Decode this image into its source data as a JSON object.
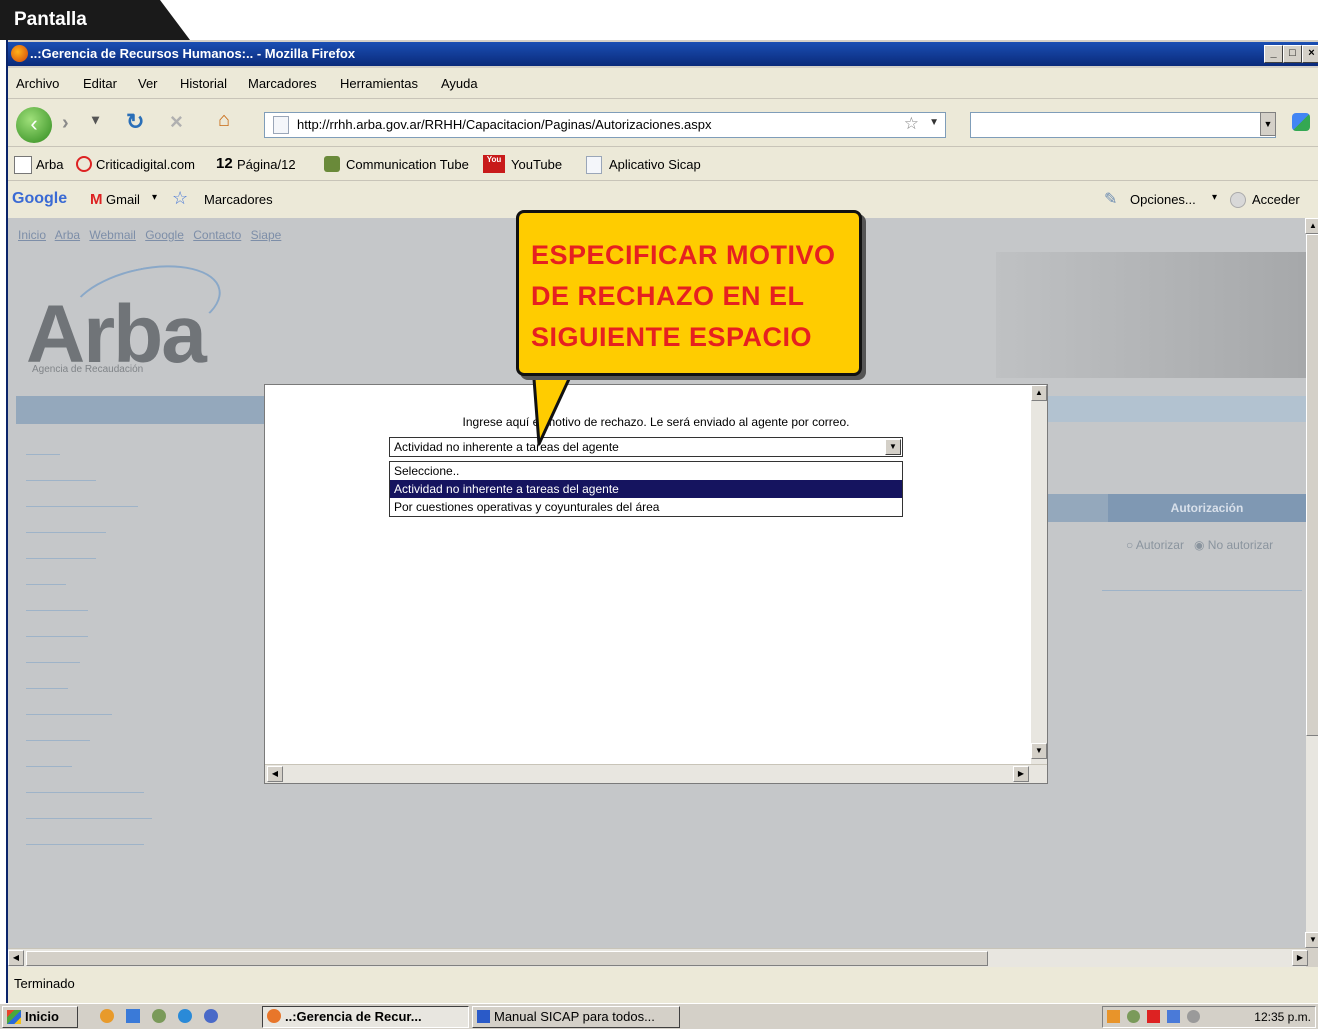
{
  "screen_label": "Pantalla",
  "window": {
    "title": "..:Gerencia de Recursos Humanos:.. - Mozilla Firefox"
  },
  "menu": [
    "Archivo",
    "Editar",
    "Ver",
    "Historial",
    "Marcadores",
    "Herramientas",
    "Ayuda"
  ],
  "address_bar": {
    "url": "http://rrhh.arba.gov.ar/RRHH/Capacitacion/Paginas/Autorizaciones.aspx"
  },
  "bookmarks": [
    "Arba",
    "Criticadigital.com",
    "Página/12",
    "Communication Tube",
    "YouTube",
    "Aplicativo Sicap"
  ],
  "bookmark_badges": {
    "pagina12": "12",
    "youtube": "You"
  },
  "google_toolbar": {
    "brand": "Google",
    "gmail": "Gmail",
    "marcadores": "Marcadores",
    "opciones": "Opciones...",
    "acceder": "Acceder"
  },
  "page": {
    "top_links": [
      "Inicio",
      "Arba",
      "Webmail",
      "Google",
      "Contacto",
      "Siape"
    ],
    "logo": "Arba",
    "logo_subtitle": "Agencia de Recaudación",
    "column_header": "Autorización",
    "radio_autorizar": "Autorizar",
    "radio_no_autorizar": "No autorizar"
  },
  "modal": {
    "prompt": "Ingrese aquí el motivo de rechazo. Le será enviado al agente por correo.",
    "selected": "Actividad no inherente a tareas del agente",
    "options": [
      "Seleccione..",
      "Actividad no inherente a tareas del agente",
      "Por cuestiones operativas y coyunturales del área"
    ]
  },
  "callout": {
    "text": "ESPECIFICAR MOTIVO DE RECHAZO EN EL SIGUIENTE ESPACIO"
  },
  "status_bar": {
    "text": "Terminado"
  },
  "taskbar": {
    "start": "Inicio",
    "task1": "..:Gerencia de Recur...",
    "task2": "Manual SICAP para todos...",
    "clock": "12:35 p.m."
  },
  "colors": {
    "titlebar": "#0a2a7a",
    "callout_bg": "#ffcc00",
    "callout_text": "#e62020",
    "selected_option": "#15145f"
  }
}
